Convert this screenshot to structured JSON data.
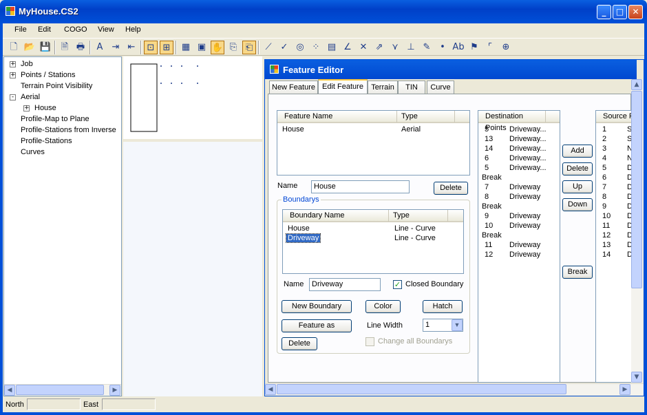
{
  "window": {
    "title": "MyHouse.CS2"
  },
  "menu": [
    "File",
    "Edit",
    "COGO",
    "View",
    "Help"
  ],
  "toolbar_icons": [
    "new-icon",
    "open-icon",
    "save-icon",
    "print-preview-icon",
    "print-icon",
    "text-icon",
    "import-icon",
    "export-icon",
    "select-icon",
    "zoom-extents-icon",
    "grid-icon",
    "layers-icon",
    "pan-icon",
    "copy-icon",
    "paste-icon",
    "line-icon",
    "check-icon",
    "circle-icon",
    "points-icon",
    "block-icon",
    "angle-icon",
    "cross-icon",
    "arrow-icon",
    "break-icon",
    "measure-icon",
    "pen-icon",
    "dot-icon",
    "abc-edit-icon",
    "flag-icon",
    "corner-icon",
    "fit-icon"
  ],
  "tree": [
    {
      "label": "Job",
      "level": 0,
      "expander": "+"
    },
    {
      "label": "Points / Stations",
      "level": 0,
      "expander": "+"
    },
    {
      "label": "Terrain Point Visibility",
      "level": 0,
      "expander": ""
    },
    {
      "label": "Aerial",
      "level": 0,
      "expander": "-"
    },
    {
      "label": "House",
      "level": 1,
      "expander": "+"
    },
    {
      "label": "Profile-Map to Plane",
      "level": 0,
      "expander": ""
    },
    {
      "label": "Profile-Stations from Inverse",
      "level": 0,
      "expander": ""
    },
    {
      "label": "Profile-Stations",
      "level": 0,
      "expander": ""
    },
    {
      "label": "Curves",
      "level": 0,
      "expander": ""
    }
  ],
  "feature_editor": {
    "title": "Feature Editor",
    "tabs": [
      "New Feature",
      "Edit Feature",
      "Terrain",
      "TIN",
      "Curve"
    ],
    "active_tab": "Edit Feature",
    "feature_list": {
      "headers": [
        "Feature Name",
        "Type"
      ],
      "rows": [
        [
          "House",
          "Aerial"
        ]
      ]
    },
    "name_label": "Name",
    "name_value": "House",
    "delete_label": "Delete",
    "boundarys": {
      "legend": "Boundarys",
      "headers": [
        "Boundary Name",
        "Type"
      ],
      "rows": [
        [
          "House",
          "Line - Curve"
        ],
        [
          "Driveway",
          "Line - Curve"
        ]
      ],
      "selected": "Driveway",
      "name_label": "Name",
      "name_value": "Driveway",
      "closed_boundary_label": "Closed Boundary",
      "closed_boundary_checked": true,
      "new_boundary_label": "New Boundary",
      "color_label": "Color",
      "hatch_label": "Hatch",
      "feature_as_label": "Feature as",
      "line_width_label": "Line Width",
      "line_width_value": "1",
      "delete_label": "Delete",
      "change_all_label": "Change all Boundarys"
    },
    "destination": {
      "header": "Destination Points",
      "rows": [
        [
          "5",
          "Driveway..."
        ],
        [
          "13",
          "Driveway..."
        ],
        [
          "14",
          "Driveway..."
        ],
        [
          "6",
          "Driveway..."
        ],
        [
          "5",
          "Driveway..."
        ],
        [
          "Break",
          ""
        ],
        [
          "7",
          "Driveway"
        ],
        [
          "8",
          "Driveway"
        ],
        [
          "Break",
          ""
        ],
        [
          "9",
          "Driveway"
        ],
        [
          "10",
          "Driveway"
        ],
        [
          "Break",
          ""
        ],
        [
          "11",
          "Driveway"
        ],
        [
          "12",
          "Driveway"
        ]
      ]
    },
    "buttons": {
      "add": "Add",
      "delete": "Delete",
      "up": "Up",
      "down": "Down",
      "break": "Break"
    },
    "source": {
      "header": "Source F",
      "rows": [
        [
          "1",
          "S"
        ],
        [
          "2",
          "S"
        ],
        [
          "3",
          "N"
        ],
        [
          "4",
          "N"
        ],
        [
          "5",
          "D"
        ],
        [
          "6",
          "D"
        ],
        [
          "7",
          "D"
        ],
        [
          "8",
          "D"
        ],
        [
          "9",
          "D"
        ],
        [
          "10",
          "D"
        ],
        [
          "11",
          "D"
        ],
        [
          "12",
          "D"
        ],
        [
          "13",
          "D"
        ],
        [
          "14",
          "D"
        ]
      ]
    }
  },
  "status": {
    "north_label": "North",
    "east_label": "East"
  }
}
